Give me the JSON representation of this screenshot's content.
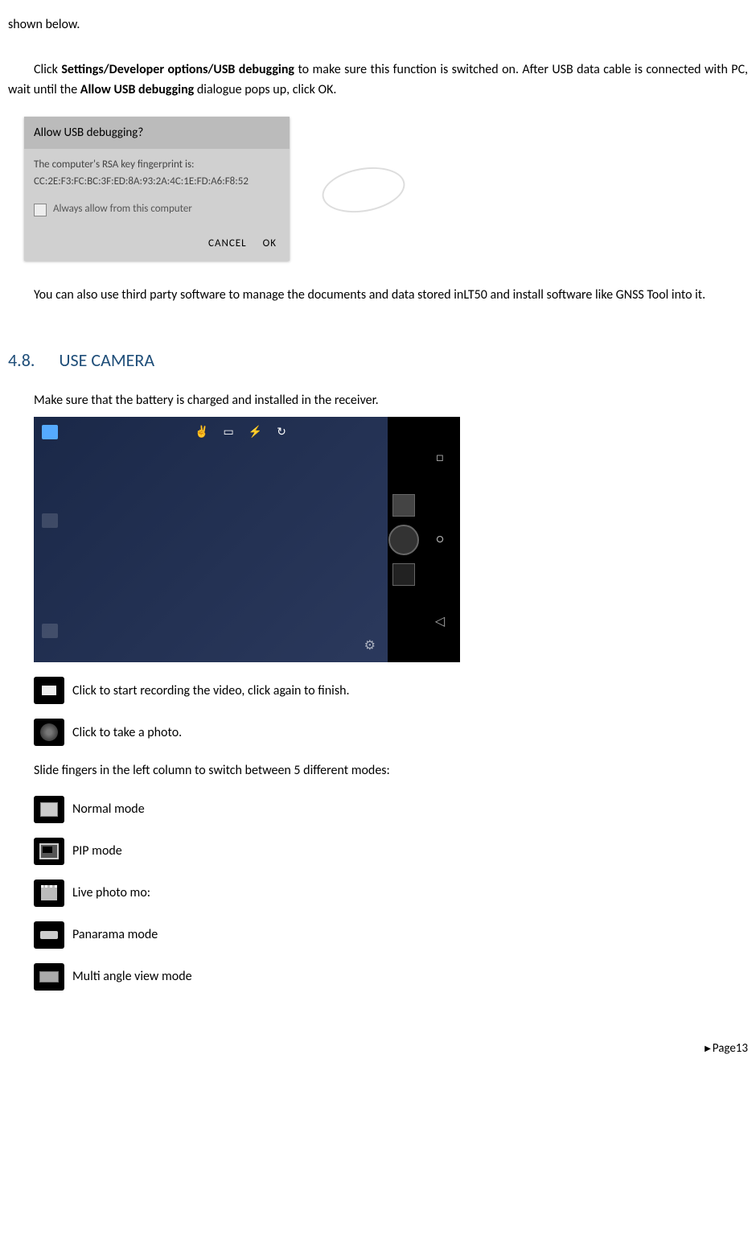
{
  "intro_fragment": "shown below.",
  "para1": {
    "prefix": "Click ",
    "bold1": "Settings/Developer options/USB debugging",
    "mid": " to make sure this function is switched on. After USB data cable is connected with PC, wait until the ",
    "bold2": "Allow USB debugging",
    "suffix": " dialogue pops up, click OK."
  },
  "dialog": {
    "title": "Allow USB debugging?",
    "body_line1": "The computer's RSA key fingerprint is:",
    "body_line2": "CC:2E:F3:FC:BC:3F:ED:8A:93:2A:4C:1E:FD:A6:F8:52",
    "checkbox_label": "Always allow from this computer",
    "cancel": "CANCEL",
    "ok": "OK"
  },
  "para2": "You can also use third party software to manage the documents and data stored inLT50 and install software like GNSS Tool into it.",
  "section": {
    "num": "4.8.",
    "title": "USE CAMERA"
  },
  "camera_intro": "Make sure that the battery is charged and installed in the receiver.",
  "items": {
    "video": "Click to start recording the video, click again to finish.",
    "photo": " Click to take a photo.",
    "slide": "Slide fingers in the left column to switch between 5 different modes:",
    "normal": " Normal mode",
    "pip": " PIP mode",
    "live": " Live photo mo:",
    "pano": " Panarama mode",
    "multi": " Multi angle view mode"
  },
  "footer": "Page13"
}
